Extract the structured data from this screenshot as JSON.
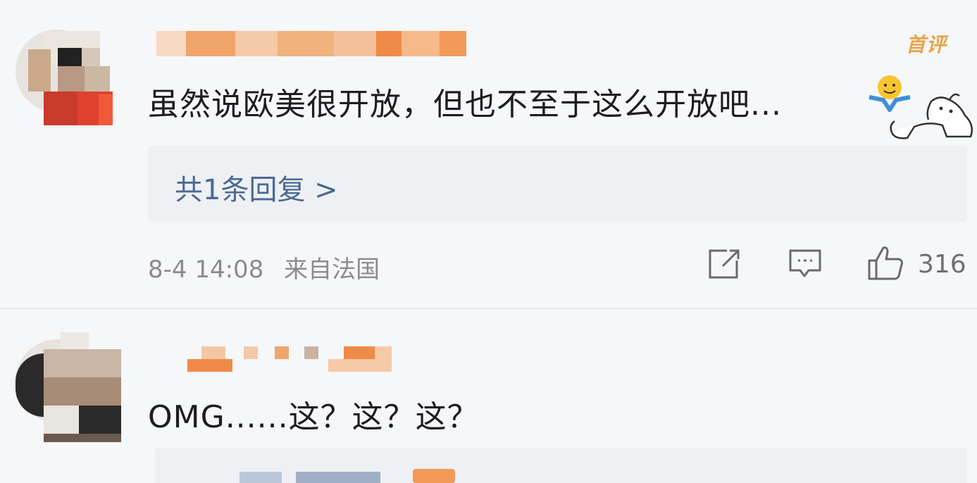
{
  "comments": [
    {
      "badge": "首评",
      "text": "虽然说欧美很开放，但也不至于这么开放吧...",
      "reply_link": "共1条回复 >",
      "timestamp": "8-4 14:08",
      "location": "来自法国",
      "likes": "316",
      "icons": [
        "share-icon",
        "comment-icon",
        "thumbs-up-icon"
      ]
    },
    {
      "text": "OMG......这？这？这？"
    }
  ],
  "colors": {
    "link": "#4a6a92",
    "badge": "#e3a64a",
    "meta": "#8b8b8f"
  }
}
